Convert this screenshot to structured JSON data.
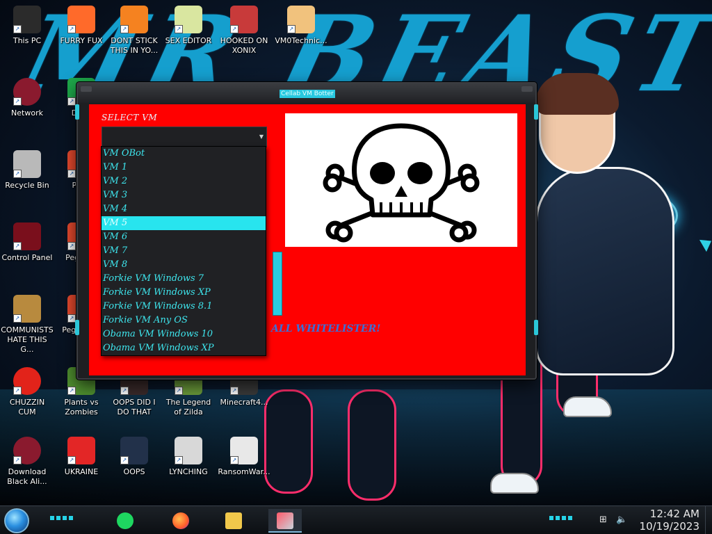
{
  "desktop": {
    "icons": [
      {
        "label": "This PC",
        "icon": "computer-icon"
      },
      {
        "label": "FURRY FUX",
        "icon": "firefox-icon"
      },
      {
        "label": "DONT STICK THIS IN YO...",
        "icon": "vlc-cone-icon"
      },
      {
        "label": "SEX EDITOR",
        "icon": "hxd-icon"
      },
      {
        "label": "HOOKED ON XONIX",
        "icon": "xonix-icon"
      },
      {
        "label": "VM0Technic...",
        "icon": "technician-icon"
      },
      {
        "label": "Network",
        "icon": "network-orb-icon"
      },
      {
        "label": "D DU",
        "icon": "app-icon"
      },
      {
        "label": "Recycle Bin",
        "icon": "recycle-bin-icon"
      },
      {
        "label": "Pegg",
        "icon": "peggle-icon"
      },
      {
        "label": "Control Panel",
        "icon": "control-panel-icon"
      },
      {
        "label": "Pegg De",
        "icon": "peggle-icon"
      },
      {
        "label": "COMMUNISTS HATE THIS G...",
        "icon": "money-bag-icon"
      },
      {
        "label": "Pegg of W",
        "icon": "peggle-icon"
      },
      {
        "label": "CHUZZIN CUM",
        "icon": "chuzzle-icon"
      },
      {
        "label": "Plants vs Zombies",
        "icon": "plants-vs-zombies-icon"
      },
      {
        "label": "OOPS DID I DO THAT",
        "icon": "game-icon"
      },
      {
        "label": "The Legend of Zilda",
        "icon": "zelda-icon"
      },
      {
        "label": "Minecraft4...",
        "icon": "minecraft-icon"
      },
      {
        "label": "Download Black Ali...",
        "icon": "orb-icon"
      },
      {
        "label": "UKRAINE",
        "icon": "radiation-icon"
      },
      {
        "label": "OOPS",
        "icon": "gear-box-icon"
      },
      {
        "label": "LYNCHING",
        "icon": "rope-icon"
      },
      {
        "label": "RansomWar...",
        "icon": "skull-icon"
      }
    ],
    "wallpaper_text": "MR BEAST"
  },
  "window": {
    "title": "Cellab VM Botter",
    "select_label": "SELECT VM",
    "combo_value": "",
    "dropdown_options": [
      "VM OBot",
      "VM 1",
      "VM 2",
      "VM 3",
      "VM 4",
      "VM 5",
      "VM 6",
      "VM 7",
      "VM 8",
      "Forkie VM Windows 7",
      "Forkie VM Windows XP",
      "Forkie VM Windows 8.1",
      "Forkie VM Any OS",
      "Obama VM Windows 10",
      "Obama VM Windows XP"
    ],
    "selected_index": 5,
    "status_text": "ALL WHITELISTER!",
    "image": "skull-and-crossbones-icon"
  },
  "taskbar": {
    "apps": [
      {
        "name": "Spotify",
        "icon": "spotify-icon",
        "active": false
      },
      {
        "name": "Firefox",
        "icon": "firefox-icon",
        "active": false
      },
      {
        "name": "File Explorer",
        "icon": "folder-icon",
        "active": false
      },
      {
        "name": "Cellab VM Botter",
        "icon": "vm-botter-icon",
        "active": true
      }
    ],
    "clock_time": "12:42 AM",
    "clock_date": "10/19/2023"
  },
  "colors": {
    "client_bg": "#ff0000",
    "accent_cyan": "#28e4ee",
    "wallpaper_blue": "#16a7d8"
  }
}
